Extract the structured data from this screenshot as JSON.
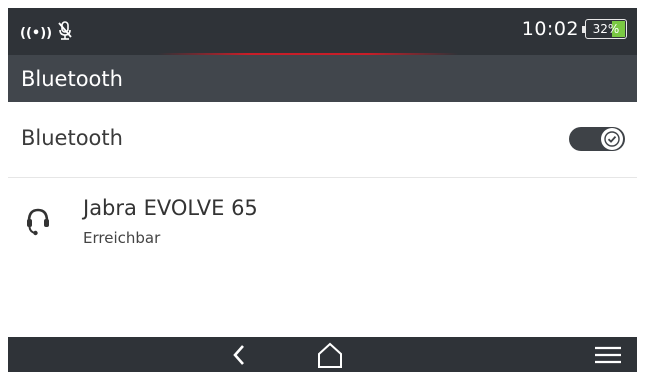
{
  "status_bar": {
    "signal_icon": "((•))",
    "mic_muted_icon": "mic-muted-icon",
    "time": "10:02",
    "battery_percent": "32%",
    "battery_level": 0.32,
    "battery_color": "#7ac943"
  },
  "title_bar": {
    "title": "Bluetooth"
  },
  "bluetooth_setting": {
    "label": "Bluetooth",
    "enabled": true
  },
  "devices": [
    {
      "name": "Jabra EVOLVE 65",
      "status": "Erreichbar",
      "icon": "headset-icon"
    }
  ],
  "nav_bar": {
    "back_icon": "back-icon",
    "home_icon": "home-icon",
    "menu_icon": "menu-icon"
  },
  "colors": {
    "status_bg": "#2f3338",
    "title_bg": "#41464c",
    "accent_red": "#c81e28"
  }
}
